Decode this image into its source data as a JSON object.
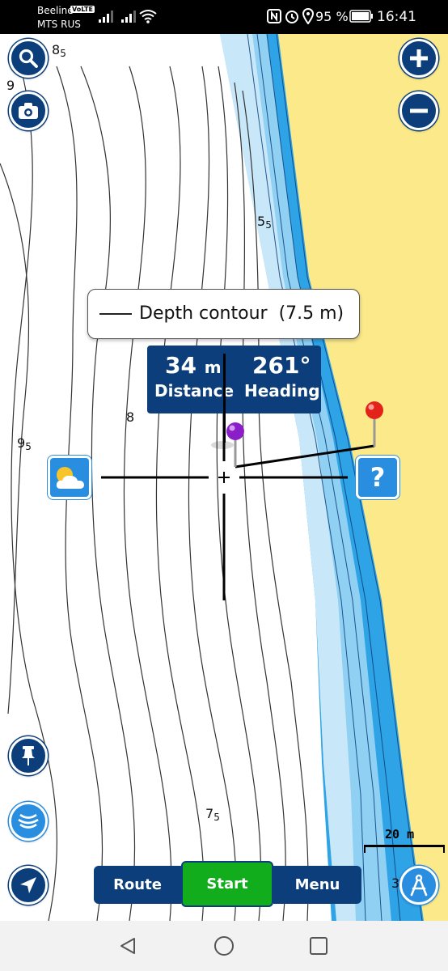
{
  "status_bar": {
    "carrier_1": "Beeline",
    "volte": "VoLTE",
    "carrier_2": "MTS RUS",
    "battery_percent": "95 %",
    "time": "16:41"
  },
  "map": {
    "depth_labels": [
      {
        "main": "8",
        "sub": "5"
      },
      {
        "main": "9",
        "sub": ""
      },
      {
        "main": "5",
        "sub": "5"
      },
      {
        "main": "8",
        "sub": ""
      },
      {
        "main": "9",
        "sub": "5"
      },
      {
        "main": "7",
        "sub": "5"
      },
      {
        "main": "3",
        "sub": ""
      }
    ],
    "colors": {
      "land": "#fbe98a",
      "shallow": "#2ea3e6",
      "mid": "#8fd0f3",
      "deep": "#c8e8fa",
      "water": "#ffffff"
    }
  },
  "tooltip": {
    "text": "Depth contour  (7.5 m)"
  },
  "measure": {
    "distance_value": "34",
    "distance_unit": "m",
    "distance_label": "Distance",
    "heading_value": "261°",
    "heading_label": "Heading"
  },
  "scale": {
    "label": "20 m"
  },
  "buttons": {
    "search": "search-icon",
    "camera": "camera-icon",
    "zoom_in": "plus-icon",
    "zoom_out": "minus-icon",
    "weather": "weather-icon",
    "help": "?",
    "pin": "pin-icon",
    "sonar": "sonar-icon",
    "locate": "navigation-arrow-icon",
    "compass": "compass-icon"
  },
  "bottom_bar": {
    "route": "Route",
    "start": "Start",
    "menu": "Menu"
  },
  "nav_bar": {
    "back": "back-icon",
    "home": "home-icon",
    "recents": "recents-icon"
  }
}
